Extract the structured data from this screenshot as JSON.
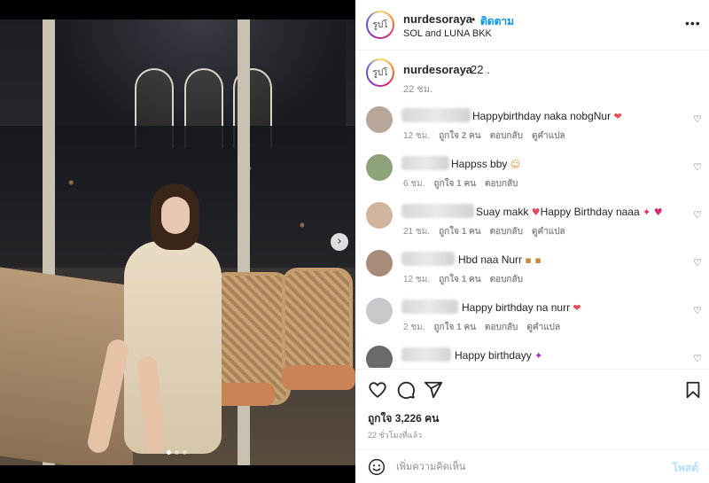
{
  "post": {
    "username": "nurdesoraya",
    "avatar_text": "รูปโ",
    "follow_label": "ติดตาม",
    "separator": "•",
    "location": "SOL and LUNA BKK",
    "more_label": "•••",
    "caption_text": "22 .",
    "caption_time": "22 ชม.",
    "next_label": "›"
  },
  "comments": [
    {
      "text": "Happybirthday naka nobgNur",
      "emoji": "❤",
      "time": "12 ชม.",
      "likes": "ถูกใจ 2 คน",
      "reply": "ตอบกลับ",
      "translate": "ดูคำแปล"
    },
    {
      "text": "Happss bby",
      "emoji": "☺",
      "time": "6 ชม.",
      "likes": "ถูกใจ 1 คน",
      "reply": "ตอบกลับ",
      "translate": ""
    },
    {
      "text": "Suay makk",
      "emoji_pre": "♥",
      "text2": "Happy Birthday naaa",
      "emoji": "✦ ♥",
      "time": "21 ชม.",
      "likes": "ถูกใจ 1 คน",
      "reply": "ตอบกลับ",
      "translate": "ดูคำแปล"
    },
    {
      "text": "Hbd naa Nurr",
      "emoji": "▪ ▪",
      "time": "12 ชม.",
      "likes": "ถูกใจ 1 คน",
      "reply": "ตอบกลับ",
      "translate": ""
    },
    {
      "text": "Happy birthday na nurr",
      "emoji": "❤",
      "time": "2 ชม.",
      "likes": "ถูกใจ 1 คน",
      "reply": "ตอบกลับ",
      "translate": "ดูคำแปล"
    },
    {
      "text": "Happy birthdayy",
      "emoji": "✦",
      "time": "",
      "likes": "",
      "reply": "",
      "translate": ""
    }
  ],
  "heart_icon_glyph": "♡",
  "likes": "ถูกใจ 3,226 คน",
  "post_time": "22 ชั่วโมงที่แล้ว",
  "comment_box": {
    "placeholder": "เพิ่มความคิดเห็น",
    "post_label": "โพสต์"
  },
  "colors": {
    "link_blue": "#0095f6",
    "post_button_disabled": "#b2dffc",
    "heart_red": "#ed4956"
  }
}
